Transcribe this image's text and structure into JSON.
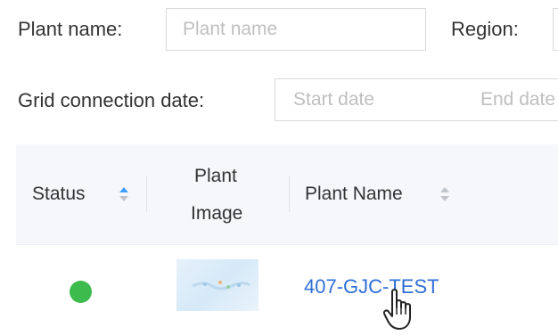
{
  "filters": {
    "plant_name": {
      "label": "Plant name:",
      "placeholder": "Plant name"
    },
    "region": {
      "label": "Region:"
    },
    "grid_connection": {
      "label": "Grid connection date:",
      "start_placeholder": "Start date",
      "end_placeholder": "End date"
    }
  },
  "table": {
    "columns": {
      "status": "Status",
      "plant_image_line1": "Plant",
      "plant_image_line2": "Image",
      "plant_name": "Plant Name"
    },
    "sort": {
      "status": "ascending",
      "plant_name": "none"
    },
    "rows": [
      {
        "status": "online",
        "status_color": "#3dbb4d",
        "plant_name": "407-GJC-TEST"
      }
    ]
  },
  "colors": {
    "link": "#2f6fd6",
    "sort_active": "#409eff",
    "sort_inactive": "#c0c4cc",
    "header_bg": "#f5f7fa",
    "border": "#d9d9d9"
  },
  "icons": {
    "status": "status-dot-icon",
    "sort": "sort-caret-icon",
    "cursor": "hand-pointer-cursor-icon"
  }
}
